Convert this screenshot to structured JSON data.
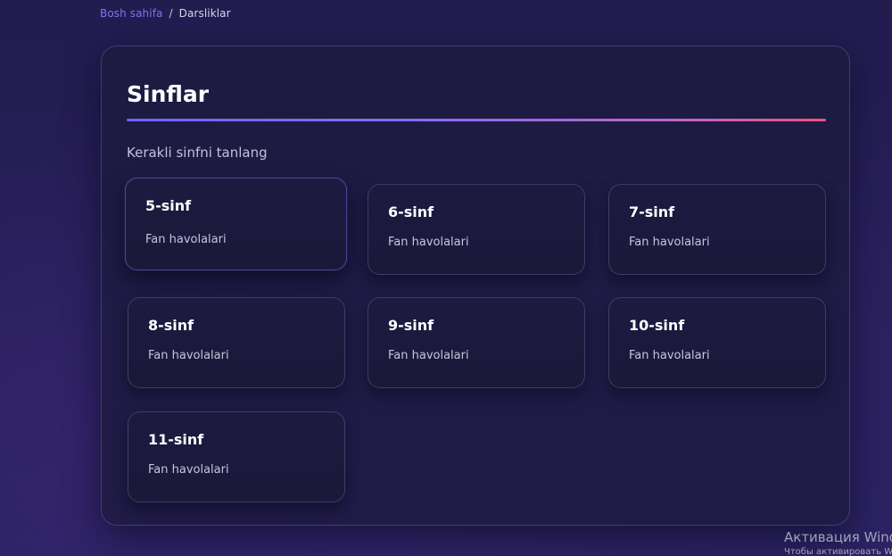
{
  "breadcrumb": {
    "home": "Bosh sahifa",
    "separator": "/",
    "current": "Darsliklar"
  },
  "panel": {
    "title": "Sinflar",
    "subtitle": "Kerakli sinfni tanlang"
  },
  "classes": [
    {
      "title": "5-sinf",
      "subtitle": "Fan havolalari"
    },
    {
      "title": "6-sinf",
      "subtitle": "Fan havolalari"
    },
    {
      "title": "7-sinf",
      "subtitle": "Fan havolalari"
    },
    {
      "title": "8-sinf",
      "subtitle": "Fan havolalari"
    },
    {
      "title": "9-sinf",
      "subtitle": "Fan havolalari"
    },
    {
      "title": "10-sinf",
      "subtitle": "Fan havolalari"
    },
    {
      "title": "11-sinf",
      "subtitle": "Fan havolalari"
    }
  ],
  "colors": {
    "accent": "#7e72f2",
    "gradient_start": "#6c63ff",
    "gradient_end": "#f0527a",
    "background": "#251e55",
    "panel": "#1e1b42"
  },
  "watermark": {
    "line1": "Активация Windows",
    "line2": "Чтобы активировать Windows, перейдите в раздел «Параметры»."
  }
}
